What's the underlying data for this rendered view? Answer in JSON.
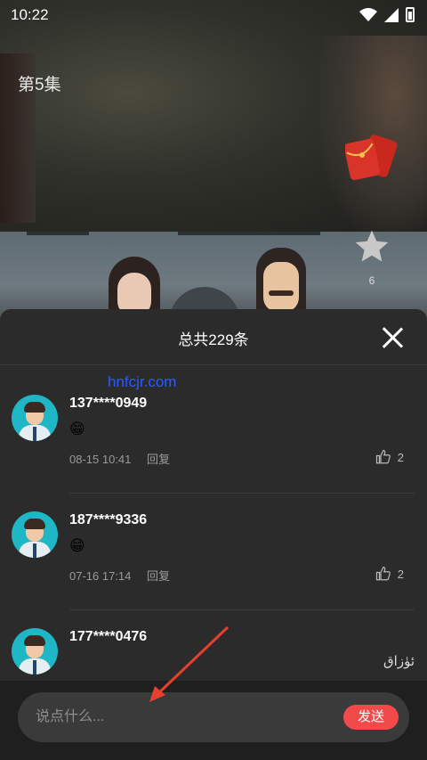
{
  "status_bar": {
    "time": "10:22"
  },
  "video": {
    "episode_title": "第5集",
    "star_count": "6"
  },
  "panel": {
    "title": "总共229条",
    "watermark": "hnfcjr.com",
    "comments": [
      {
        "user": "137****0949",
        "emoji": "😁",
        "time": "08-15 10:41",
        "reply": "回复",
        "likes": "2"
      },
      {
        "user": "187****9336",
        "emoji": "😁",
        "time": "07-16 17:14",
        "reply": "回复",
        "likes": "2"
      },
      {
        "user": "177****0476"
      }
    ],
    "uyghur_text": "ئۈزاق"
  },
  "input": {
    "placeholder": "说点什么...",
    "send_label": "发送"
  },
  "colors": {
    "accent": "#f24a4a",
    "panel_bg": "#2b2b2b",
    "avatar_bg": "#1fb6c5"
  }
}
